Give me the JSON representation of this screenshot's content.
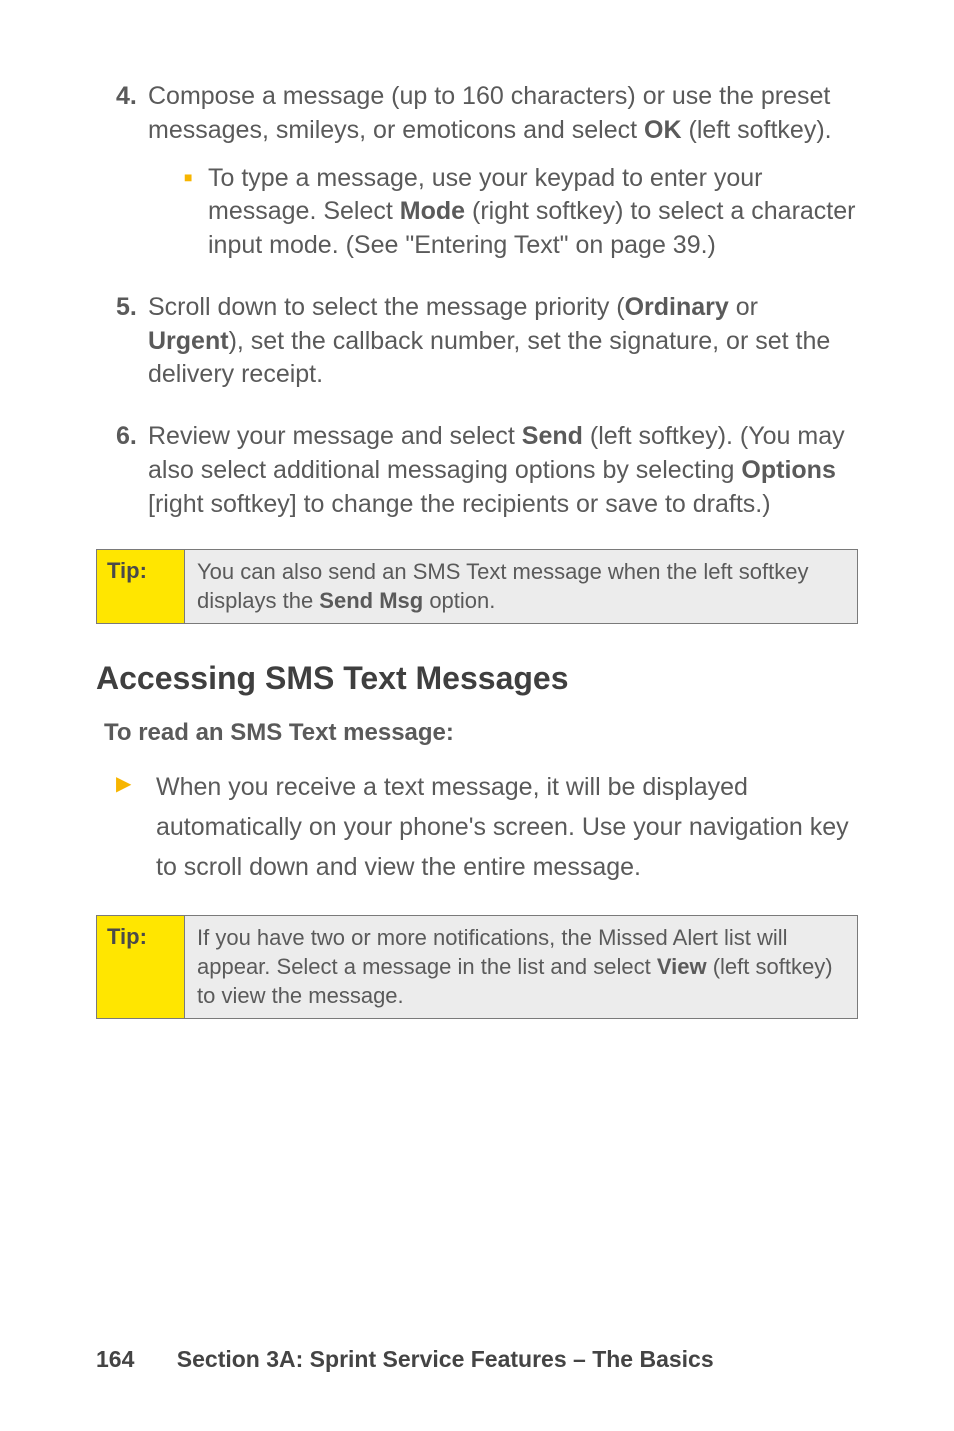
{
  "steps": [
    {
      "num": "4.",
      "body_pre": "Compose a message (up to 160 characters) or use the preset messages, smileys, or emoticons and select ",
      "body_bold1": "OK",
      "body_post": " (left softkey).",
      "sub_pre": "To type a message, use your keypad to enter your message. Select ",
      "sub_bold": "Mode",
      "sub_post": " (right softkey) to select a character input mode. (See \"Entering Text\" on page 39.)"
    },
    {
      "num": "5.",
      "body_pre": "Scroll down to select the message priority (",
      "body_bold1": "Ordinary",
      "body_mid": " or ",
      "body_bold2": "Urgent",
      "body_post": "), set the callback number, set the signature, or set the delivery receipt."
    },
    {
      "num": "6.",
      "body_pre": "Review your message and select ",
      "body_bold1": "Send",
      "body_mid": " (left softkey). (You may also select additional messaging options by selecting ",
      "body_bold2": "Options",
      "body_post": " [right softkey] to change the recipients or save to drafts.)"
    }
  ],
  "tip1": {
    "label": "Tip:",
    "pre": "You can also send an SMS Text message when the left softkey displays the ",
    "bold": "Send Msg",
    "post": " option."
  },
  "section_heading": "Accessing SMS Text Messages",
  "sub_heading": "To read an SMS Text message:",
  "bullet": {
    "text": "When you receive a text message, it will be displayed automatically on your phone's screen. Use your navigation key to scroll down and view the entire message."
  },
  "tip2": {
    "label": "Tip:",
    "pre": "If you have two or more notifications, the Missed Alert list will appear. Select a message in the list and select ",
    "bold": "View",
    "post": " (left softkey) to view the message."
  },
  "footer": {
    "page": "164",
    "title": "Section 3A: Sprint Service Features – The Basics"
  }
}
